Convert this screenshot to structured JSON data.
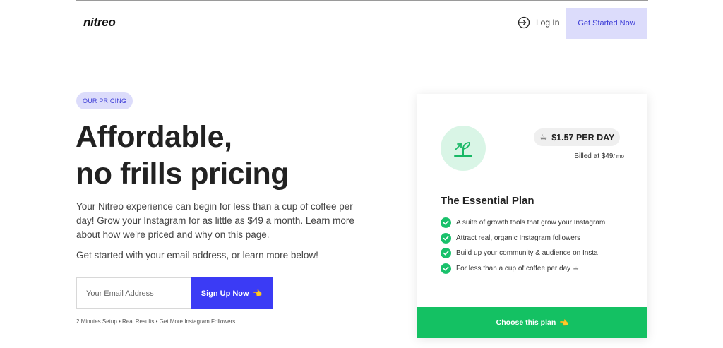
{
  "header": {
    "logo": "nitreo",
    "login_label": "Log In",
    "cta_label": "Get Started Now"
  },
  "hero": {
    "badge": "OUR PRICING",
    "headline_line1": "Affordable,",
    "headline_line2": "no frills pricing",
    "paragraph": "Your Nitreo experience can begin for less than a cup of coffee per day! Grow your Instagram for as little as $49 a month. Learn more about how we're priced and why on this page.",
    "paragraph2": "Get started with your email address, or learn more below!",
    "email_placeholder": "Your Email Address",
    "signup_label": "Sign Up Now",
    "signup_emoji": "👈",
    "footnote": "2 Minutes Setup • Real Results • Get More Instagram Followers"
  },
  "plan": {
    "price_emoji": "☕",
    "price": "$1.57 PER DAY",
    "billed": "Billed at $49",
    "billed_per": "/ mo",
    "title": "The Essential Plan",
    "features": [
      "A suite of growth tools that grow your Instagram",
      "Attract real, organic Instagram followers",
      "Build up your community & audience on Insta",
      "For less than a cup of coffee per day ☕"
    ],
    "choose_label": "Choose this plan",
    "choose_emoji": "👈"
  },
  "colors": {
    "accent": "#3b3bf5",
    "accent_light": "#dcdcfb",
    "green": "#14c163",
    "plant_bg": "#d9f5e6"
  },
  "icons": {
    "login": "login-arrow-icon",
    "plant": "growth-plant-icon",
    "check": "check-circle-icon"
  }
}
